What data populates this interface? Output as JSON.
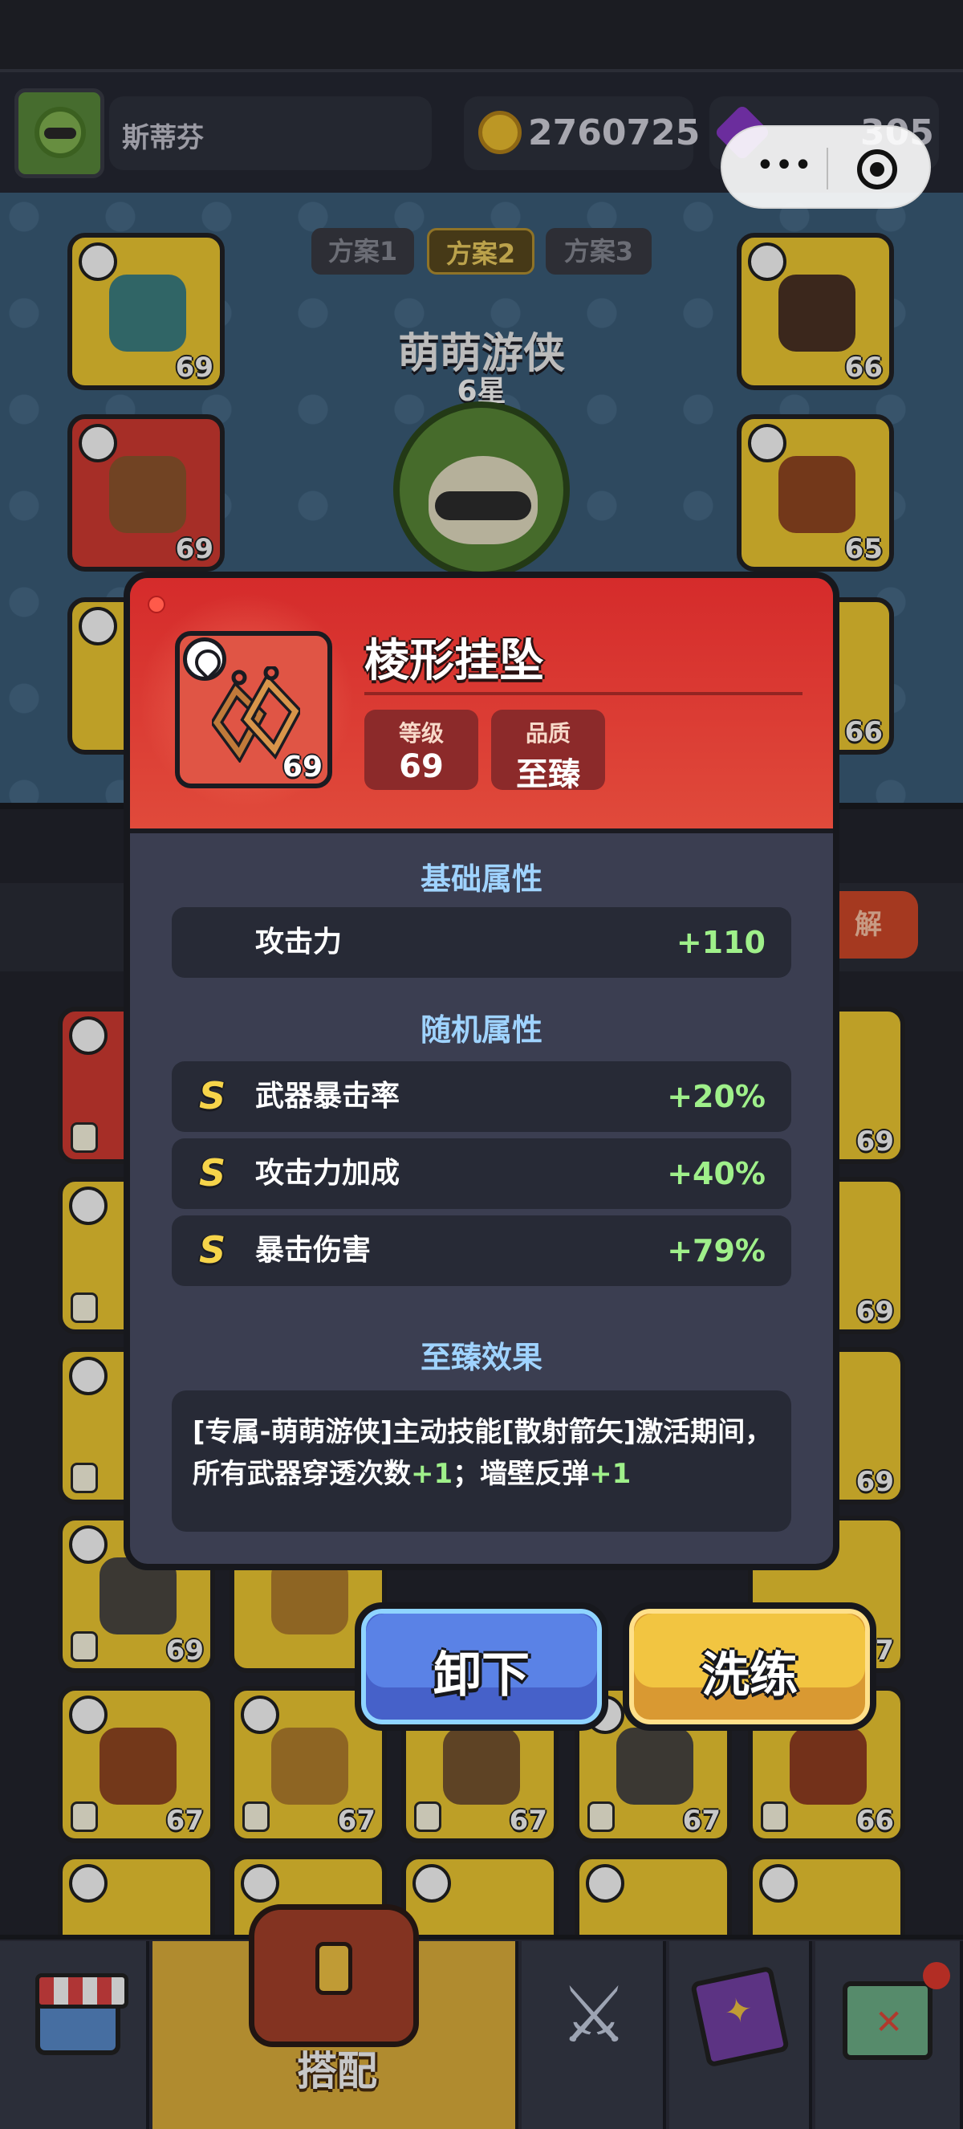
{
  "hud": {
    "player_name": "斯蒂芬",
    "coins": "2760725",
    "gems": "305"
  },
  "capsule": {
    "menu_glyph": "•••"
  },
  "presets": [
    "方案1",
    "方案2",
    "方案3"
  ],
  "hero": {
    "name": "萌萌游侠",
    "stars": "6星"
  },
  "equipped_slots": {
    "left": [
      {
        "level": "69"
      },
      {
        "level": "69"
      },
      {
        "level": ""
      }
    ],
    "right": [
      {
        "level": "66"
      },
      {
        "level": "65"
      },
      {
        "level": "66"
      }
    ]
  },
  "side_button": {
    "label": "分解",
    "visible_label": "解"
  },
  "inventory_levels": {
    "row1": [
      "",
      "",
      "",
      "",
      "69"
    ],
    "row2": [
      "",
      "",
      "",
      "",
      "69"
    ],
    "row3": [
      "",
      "",
      "",
      "",
      "69"
    ],
    "row4": [
      "69",
      "",
      "",
      "",
      "7"
    ],
    "row5": [
      "67",
      "67",
      "67",
      "67",
      "66"
    ]
  },
  "modal": {
    "item_name": "棱形挂坠",
    "item_level": "69",
    "level_caption": "等级",
    "level_value": "69",
    "quality_caption": "品质",
    "quality_value": "至臻",
    "base_title": "基础属性",
    "base_stats": [
      {
        "label": "攻击力",
        "value": "+110"
      }
    ],
    "random_title": "随机属性",
    "random_stats": [
      {
        "grade": "S",
        "label": "武器暴击率",
        "value": "+20%"
      },
      {
        "grade": "S",
        "label": "攻击力加成",
        "value": "+40%"
      },
      {
        "grade": "S",
        "label": "暴击伤害",
        "value": "+79%"
      }
    ],
    "perfect_title": "至臻效果",
    "perfect_effect": {
      "part1": "[专属-萌萌游侠]主动技能[散射箭矢]激活期间，所有武器穿透次数",
      "highlight1": "+1",
      "part2": "；墙壁反弹",
      "highlight2": "+1"
    }
  },
  "buttons": {
    "unequip": "卸下",
    "reforge": "洗练"
  },
  "bottom_nav": {
    "equip_label": "搭配"
  },
  "colors": {
    "modal_header": "#d52b2b",
    "stat_value": "#9ff08a",
    "section_title": "#9fd3ff",
    "unequip_button": "#5a82e6",
    "reforge_button": "#f2c541",
    "slot_gold": "#f2cc33"
  }
}
